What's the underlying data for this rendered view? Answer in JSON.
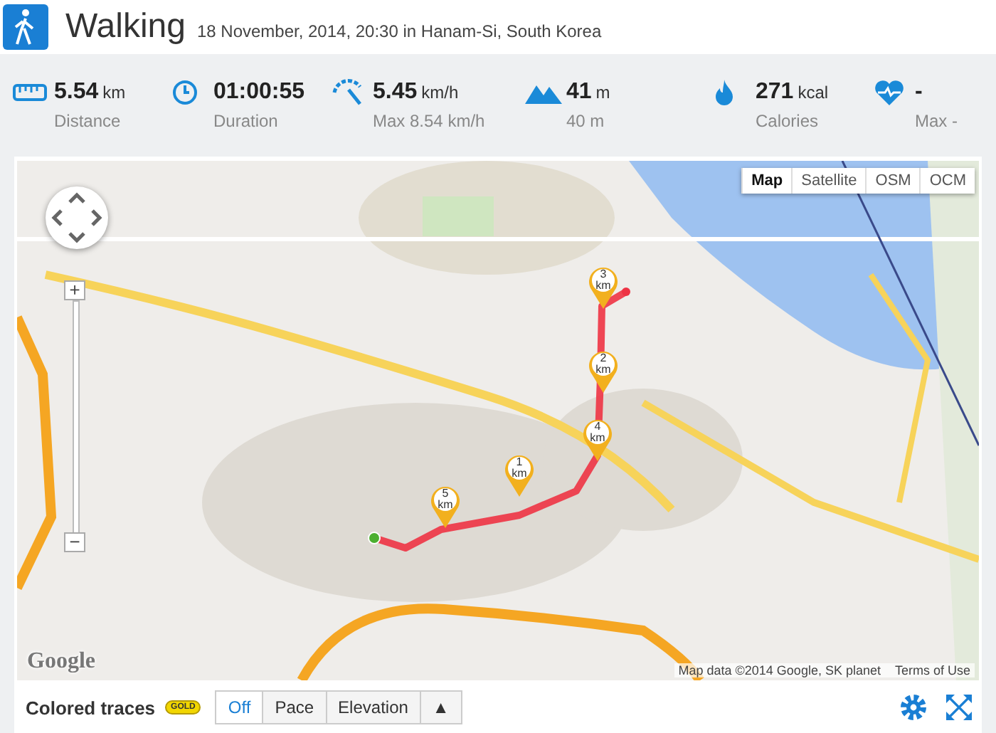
{
  "header": {
    "title": "Walking",
    "subtitle": "18 November, 2014, 20:30 in Hanam-Si, South Korea"
  },
  "stats": [
    {
      "kind": "distance",
      "value": "5.54",
      "unit": "km",
      "label": "Distance"
    },
    {
      "kind": "duration",
      "value": "01:00:55",
      "label": "Duration"
    },
    {
      "kind": "speed",
      "value": "5.45",
      "unit": "km/h",
      "label": "Max 8.54 km/h"
    },
    {
      "kind": "elevation",
      "value": "41",
      "unit": "m",
      "label": "40 m"
    },
    {
      "kind": "calories",
      "value": "271",
      "unit": "kcal",
      "label": "Calories"
    },
    {
      "kind": "heart",
      "value": "-",
      "label": "Max -"
    }
  ],
  "map": {
    "kind": "picture",
    "map_types": [
      {
        "label": "Map",
        "selected": true
      },
      {
        "label": "Satellite",
        "selected": false
      },
      {
        "label": "OSM",
        "selected": false
      },
      {
        "label": "OCM",
        "selected": false
      }
    ],
    "zoom_in": "+",
    "zoom_out": "−",
    "markers": [
      {
        "number": "5",
        "unit": "km"
      },
      {
        "number": "1",
        "unit": "km"
      },
      {
        "number": "4",
        "unit": "km"
      },
      {
        "number": "2",
        "unit": "km"
      },
      {
        "number": "3",
        "unit": "km"
      }
    ],
    "logo": "Google",
    "attribution": "Map data ©2014 Google, SK planet",
    "terms": "Terms of Use"
  },
  "toolbar": {
    "label": "Colored traces",
    "badge": "GOLD",
    "modes": [
      {
        "label": "Off",
        "selected": true
      },
      {
        "label": "Pace",
        "selected": false
      },
      {
        "label": "Elevation",
        "selected": false
      },
      {
        "label": "▲",
        "selected": false
      }
    ]
  }
}
